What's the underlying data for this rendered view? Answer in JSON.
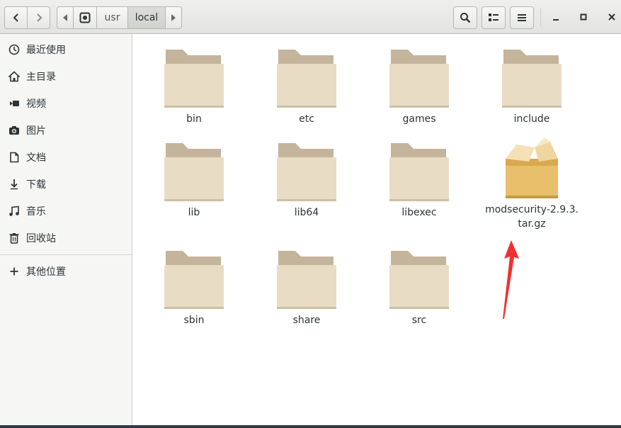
{
  "header": {
    "path": [
      "usr",
      "local"
    ]
  },
  "sidebar": {
    "items": [
      {
        "label": "最近使用",
        "icon": "clock-icon"
      },
      {
        "label": "主目录",
        "icon": "home-icon"
      },
      {
        "label": "视频",
        "icon": "video-icon"
      },
      {
        "label": "图片",
        "icon": "camera-icon"
      },
      {
        "label": "文档",
        "icon": "document-icon"
      },
      {
        "label": "下载",
        "icon": "download-icon"
      },
      {
        "label": "音乐",
        "icon": "music-icon"
      },
      {
        "label": "回收站",
        "icon": "trash-icon"
      }
    ],
    "other": {
      "label": "其他位置",
      "icon": "plus-icon"
    }
  },
  "files": [
    {
      "name": "bin",
      "type": "folder"
    },
    {
      "name": "etc",
      "type": "folder"
    },
    {
      "name": "games",
      "type": "folder"
    },
    {
      "name": "include",
      "type": "folder"
    },
    {
      "name": "lib",
      "type": "folder"
    },
    {
      "name": "lib64",
      "type": "folder"
    },
    {
      "name": "libexec",
      "type": "folder"
    },
    {
      "name": "modsecurity-2.9.3.\ntar.gz",
      "type": "archive"
    },
    {
      "name": "sbin",
      "type": "folder"
    },
    {
      "name": "share",
      "type": "folder"
    },
    {
      "name": "src",
      "type": "folder"
    }
  ],
  "colors": {
    "folder_tab": "#c3b49b",
    "folder_body": "#e9dcc4",
    "annotation_arrow": "#f03030"
  }
}
